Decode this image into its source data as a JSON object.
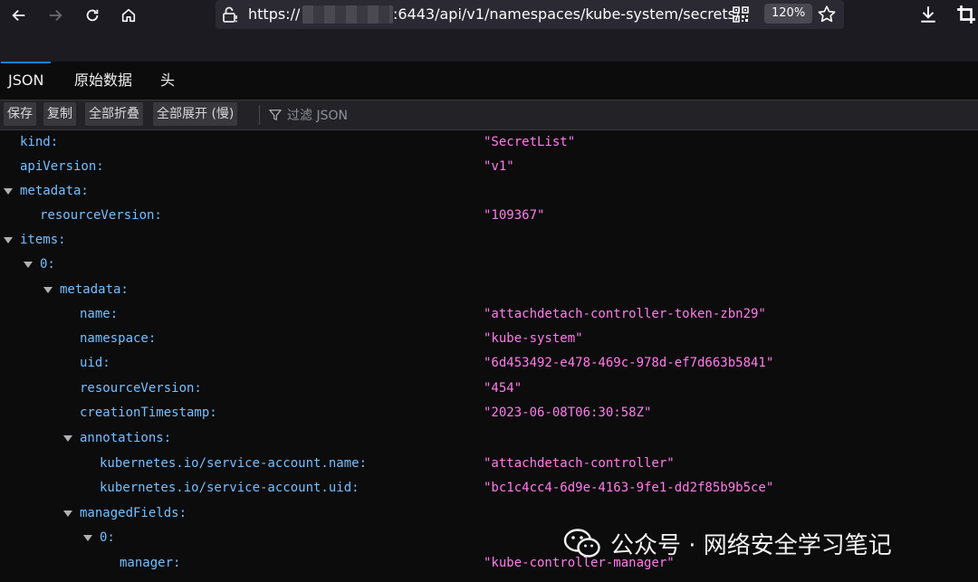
{
  "browser": {
    "url_prefix": "https://",
    "url_path": ":6443/api/v1/namespaces/kube-system/secrets/",
    "zoom": "120%"
  },
  "tabs": [
    {
      "label": "JSON",
      "active": true
    },
    {
      "label": "原始数据",
      "active": false
    },
    {
      "label": "头",
      "active": false
    }
  ],
  "toolbar": {
    "save": "保存",
    "copy": "复制",
    "collapse_all": "全部折叠",
    "expand_all": "全部展开 (慢)",
    "filter_placeholder": "过滤 JSON"
  },
  "rows": [
    {
      "key": "kind:",
      "value": "\"SecretList\""
    },
    {
      "key": "apiVersion:",
      "value": "\"v1\""
    },
    {
      "key": "metadata:",
      "value": ""
    },
    {
      "key": "resourceVersion:",
      "value": "\"109367\""
    },
    {
      "key": "items:",
      "value": ""
    },
    {
      "key": "0:",
      "value": ""
    },
    {
      "key": "metadata:",
      "value": ""
    },
    {
      "key": "name:",
      "value": "\"attachdetach-controller-token-zbn29\""
    },
    {
      "key": "namespace:",
      "value": "\"kube-system\""
    },
    {
      "key": "uid:",
      "value": "\"6d453492-e478-469c-978d-ef7d663b5841\""
    },
    {
      "key": "resourceVersion:",
      "value": "\"454\""
    },
    {
      "key": "creationTimestamp:",
      "value": "\"2023-06-08T06:30:58Z\""
    },
    {
      "key": "annotations:",
      "value": ""
    },
    {
      "key": "kubernetes.io/service-account.name:",
      "value": "\"attachdetach-controller\""
    },
    {
      "key": "kubernetes.io/service-account.uid:",
      "value": "\"bc1c4cc4-6d9e-4163-9fe1-dd2f85b9b5ce\""
    },
    {
      "key": "managedFields:",
      "value": ""
    },
    {
      "key": "0:",
      "value": ""
    },
    {
      "key": "manager:",
      "value": "\"kube-controller-manager\""
    }
  ],
  "watermark": {
    "text": "公众号 · 网络安全学习笔记"
  }
}
